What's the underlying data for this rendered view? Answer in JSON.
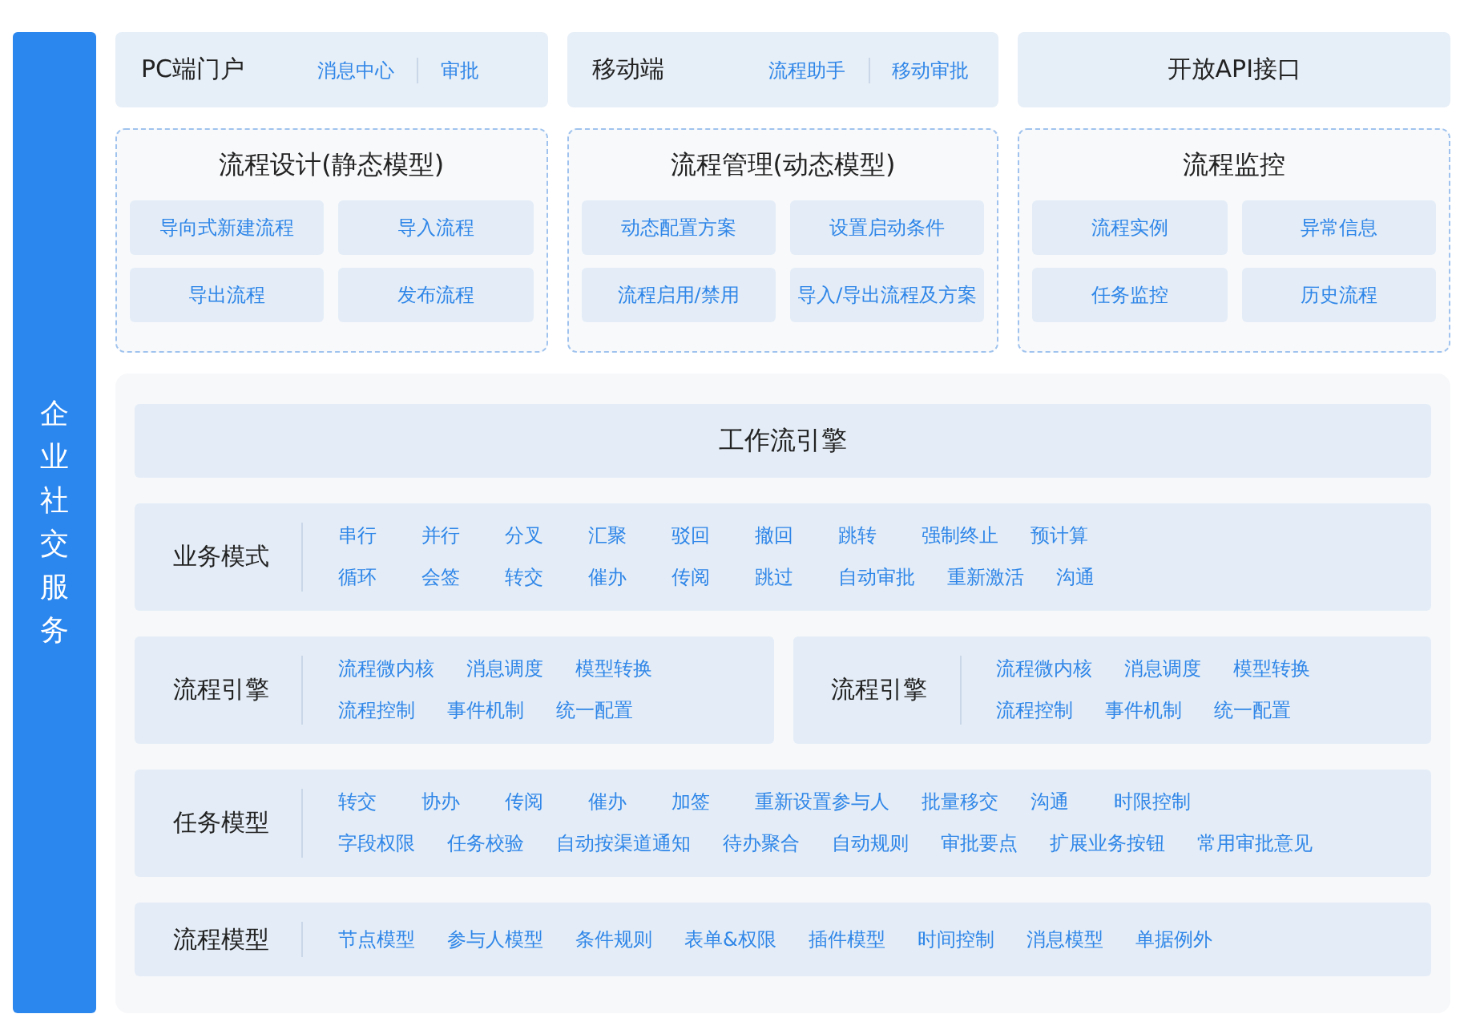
{
  "sidebar": {
    "title": "企业社交服务"
  },
  "portals": [
    {
      "title": "PC端门户",
      "links": [
        "消息中心",
        "审批"
      ]
    },
    {
      "title": "移动端",
      "links": [
        "流程助手",
        "移动审批"
      ]
    },
    {
      "title": "开放API接口"
    }
  ],
  "modules": [
    {
      "title": "流程设计(静态模型)",
      "items": [
        "导向式新建流程",
        "导入流程",
        "导出流程",
        "发布流程"
      ]
    },
    {
      "title": "流程管理(动态模型)",
      "items": [
        "动态配置方案",
        "设置启动条件",
        "流程启用/禁用",
        "导入/导出流程及方案"
      ]
    },
    {
      "title": "流程监控",
      "items": [
        "流程实例",
        "异常信息",
        "任务监控",
        "历史流程"
      ]
    }
  ],
  "engine": {
    "title": "工作流引擎",
    "rows": [
      [
        {
          "title": "业务模式",
          "lines": [
            [
              "串行",
              "并行",
              "分叉",
              "汇聚",
              "驳回",
              "撤回",
              "跳转",
              "强制终止",
              "预计算"
            ],
            [
              "循环",
              "会签",
              "转交",
              "催办",
              "传阅",
              "跳过",
              "自动审批",
              "重新激活",
              "沟通"
            ]
          ]
        }
      ],
      [
        {
          "title": "流程引擎",
          "lines": [
            [
              "流程微内核",
              "消息调度",
              "模型转换"
            ],
            [
              "流程控制",
              "事件机制",
              "统一配置"
            ]
          ]
        },
        {
          "title": "流程引擎",
          "lines": [
            [
              "流程微内核",
              "消息调度",
              "模型转换"
            ],
            [
              "流程控制",
              "事件机制",
              "统一配置"
            ]
          ]
        }
      ],
      [
        {
          "title": "任务模型",
          "lines": [
            [
              "转交",
              "协办",
              "传阅",
              "催办",
              "加签",
              "重新设置参与人",
              "批量移交",
              "沟通",
              "时限控制"
            ],
            [
              "字段权限",
              "任务校验",
              "自动按渠道通知",
              "待办聚合",
              "自动规则",
              "审批要点",
              "扩展业务按钮",
              "常用审批意见"
            ]
          ]
        }
      ],
      [
        {
          "title": "流程模型",
          "lines": [
            [
              "节点模型",
              "参与人模型",
              "条件规则",
              "表单&权限",
              "插件模型",
              "时间控制",
              "消息模型",
              "单据例外"
            ]
          ]
        }
      ]
    ]
  }
}
